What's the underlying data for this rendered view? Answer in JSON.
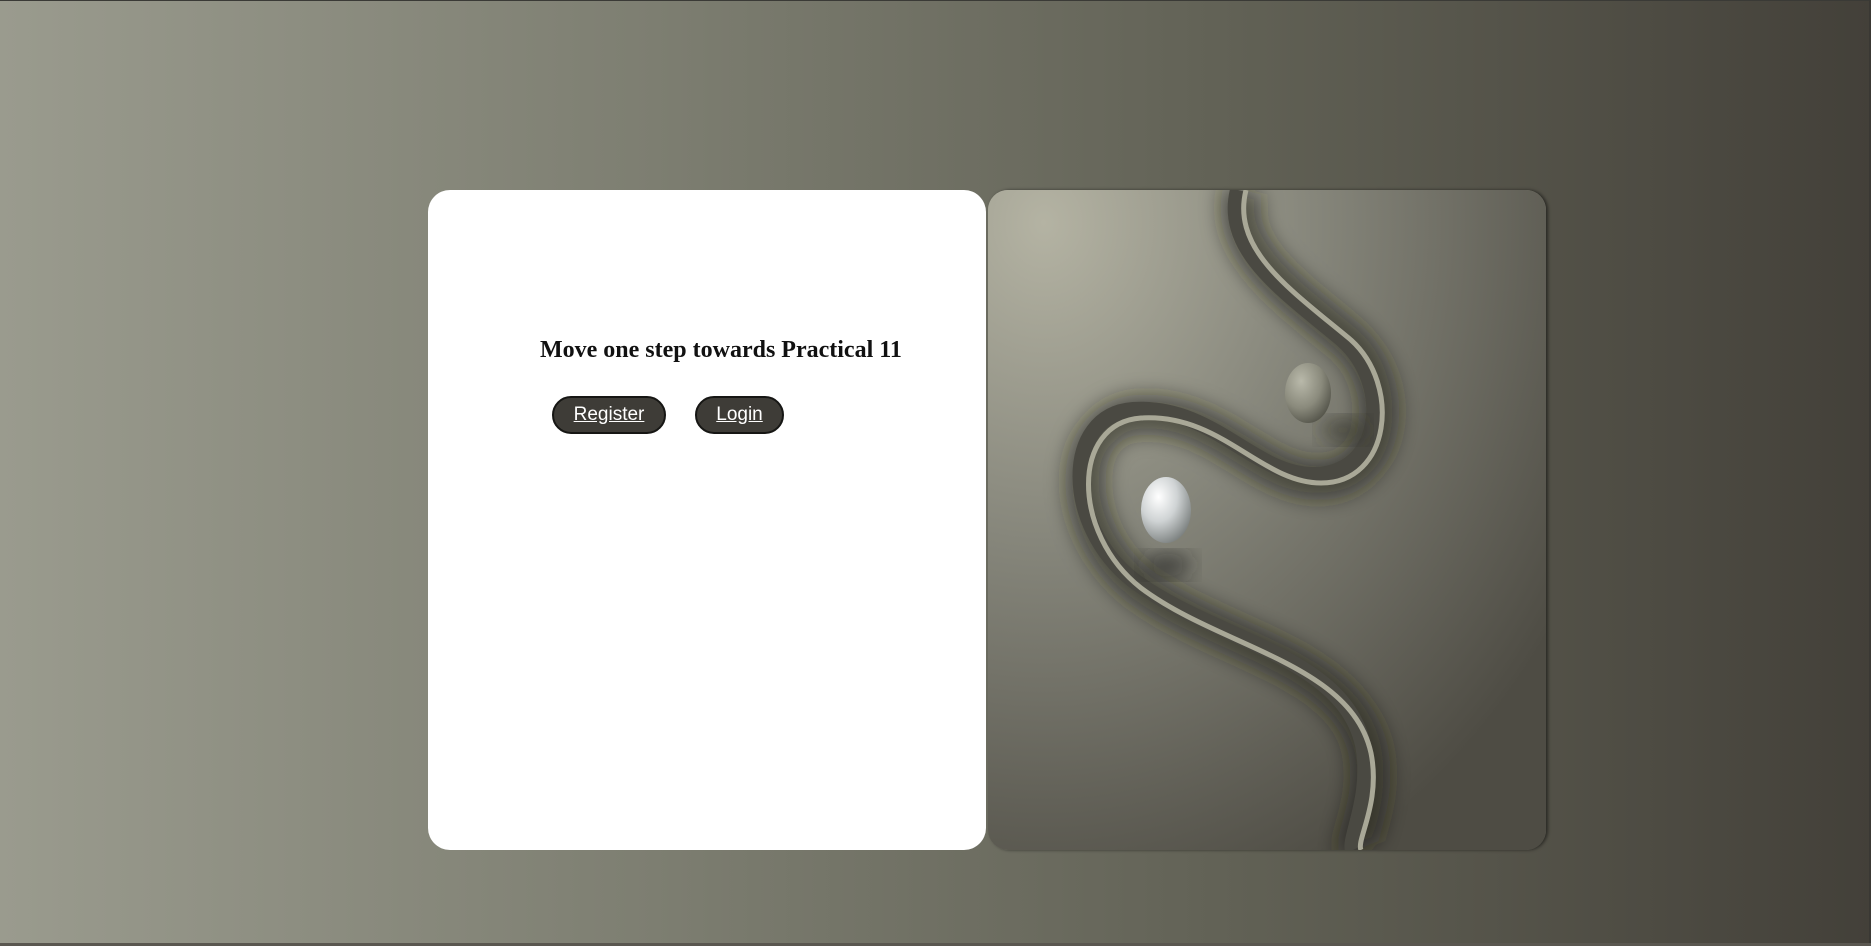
{
  "page": {
    "headline": "Move one step towards Practical 11",
    "buttons": {
      "register_label": "Register",
      "login_label": "Login"
    }
  },
  "colors": {
    "background_gradient": [
      "#9a9b8e",
      "#434039"
    ],
    "card": "#ffffff",
    "button_fill": "#3e3c37",
    "button_text": "#ffffff",
    "headline_text": "#111111"
  },
  "image": {
    "subject": "abstract-ribbon-spheres-artwork"
  }
}
